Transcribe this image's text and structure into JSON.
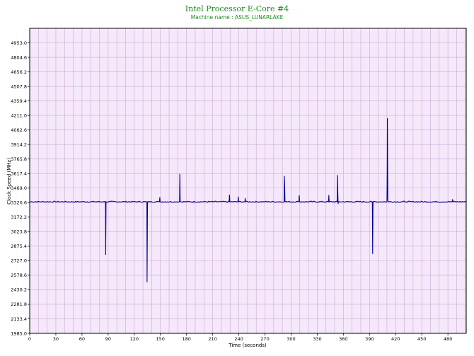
{
  "chart_data": {
    "type": "line",
    "title": "Intel Processor E-Core #4",
    "subtitle": "Machine name : ASUS_LUNARLAKE",
    "xlabel": "Time (seconds)",
    "ylabel": "Clock Speed (MHz)",
    "xlim": [
      0,
      501
    ],
    "ylim": [
      1985.0,
      5101.2
    ],
    "xticks": [
      0,
      30,
      60,
      90,
      120,
      150,
      180,
      210,
      240,
      270,
      300,
      330,
      360,
      390,
      420,
      450,
      480
    ],
    "xtick_labels": [
      "0",
      "30",
      "60",
      "90",
      "120",
      "150",
      "180",
      "210",
      "240",
      "270",
      "300",
      "330",
      "360",
      "390",
      "420",
      "450",
      "480"
    ],
    "yticks": [
      1985.0,
      2133.4,
      2281.8,
      2430.2,
      2578.6,
      2727.0,
      2875.4,
      3023.8,
      3172.2,
      3320.6,
      3469.0,
      3617.4,
      3765.8,
      3914.2,
      4062.6,
      4211.0,
      4359.4,
      4507.8,
      4656.2,
      4804.6,
      4953.0
    ],
    "ytick_labels": [
      "1985.0",
      "2133.4",
      "2281.8",
      "2430.2",
      "2578.6",
      "2727.0",
      "2875.4",
      "3023.8",
      "3172.2",
      "3320.6",
      "3469.0",
      "3617.4",
      "3765.8",
      "3914.2",
      "4062.6",
      "4211.0",
      "4359.4",
      "4507.8",
      "4656.2",
      "4804.6",
      "4953.0"
    ],
    "grid": true,
    "colors": {
      "background": "#f5e8fb",
      "grid": "#c9a9d3",
      "line": "#000099",
      "title": "#1f8a1f"
    },
    "baseline": 3330,
    "series": [
      {
        "points": [
          [
            0,
            3330
          ],
          [
            86.5,
            3330
          ],
          [
            87,
            3310
          ],
          [
            87.2,
            2790
          ],
          [
            87.6,
            3330
          ],
          [
            134,
            3330
          ],
          [
            134.5,
            3320
          ],
          [
            134.7,
            2510
          ],
          [
            135.2,
            3300
          ],
          [
            135.5,
            3330
          ],
          [
            149,
            3330
          ],
          [
            149.3,
            3372
          ],
          [
            149.7,
            3330
          ],
          [
            172,
            3330
          ],
          [
            172.3,
            3610
          ],
          [
            172.7,
            3335
          ],
          [
            173,
            3330
          ],
          [
            229,
            3330
          ],
          [
            229.3,
            3398
          ],
          [
            229.7,
            3340
          ],
          [
            230,
            3330
          ],
          [
            239,
            3330
          ],
          [
            239.3,
            3378
          ],
          [
            239.7,
            3330
          ],
          [
            247,
            3330
          ],
          [
            247.3,
            3364
          ],
          [
            247.7,
            3330
          ],
          [
            292,
            3330
          ],
          [
            292.3,
            3590
          ],
          [
            292.6,
            3500
          ],
          [
            293,
            3330
          ],
          [
            309,
            3330
          ],
          [
            309.3,
            3392
          ],
          [
            309.7,
            3335
          ],
          [
            310,
            3330
          ],
          [
            343,
            3330
          ],
          [
            343.3,
            3395
          ],
          [
            343.7,
            3335
          ],
          [
            344,
            3330
          ],
          [
            353,
            3330
          ],
          [
            353.3,
            3600
          ],
          [
            353.7,
            3400
          ],
          [
            354,
            3310
          ],
          [
            354.3,
            3330
          ],
          [
            393,
            3330
          ],
          [
            393.3,
            3310
          ],
          [
            393.6,
            2800
          ],
          [
            394,
            3330
          ],
          [
            410,
            3330
          ],
          [
            410.3,
            3630
          ],
          [
            410.5,
            4180
          ],
          [
            410.7,
            3880
          ],
          [
            411,
            3350
          ],
          [
            411.3,
            3330
          ],
          [
            485,
            3330
          ],
          [
            485.3,
            3352
          ],
          [
            485.7,
            3330
          ],
          [
            501,
            3330
          ]
        ]
      }
    ]
  }
}
